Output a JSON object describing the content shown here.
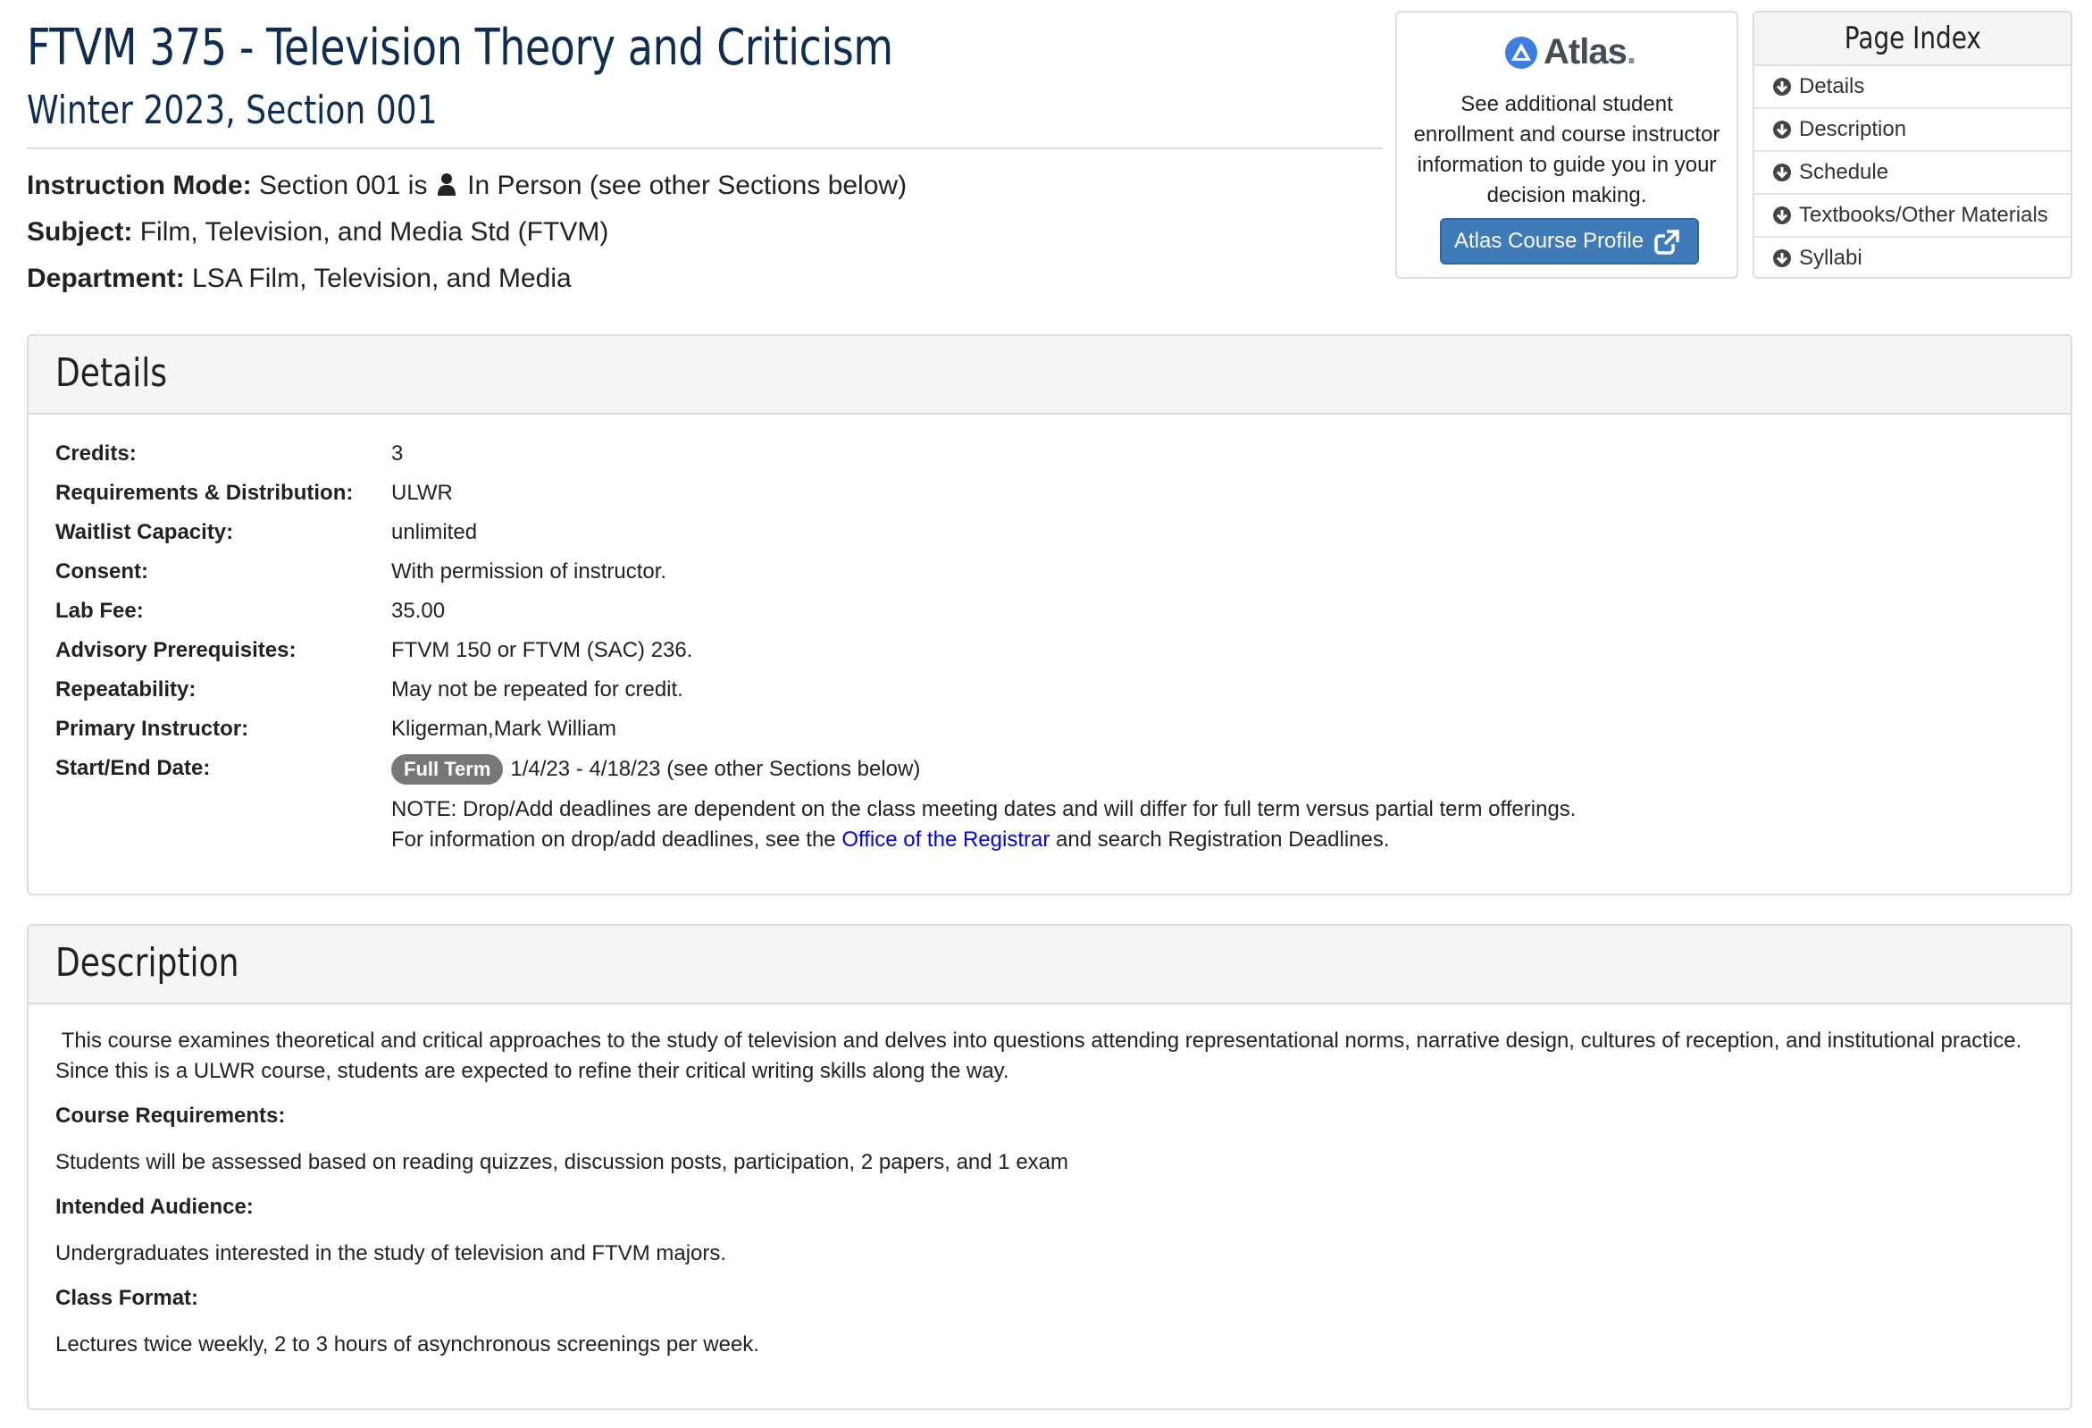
{
  "header": {
    "title": "FTVM 375 - Television Theory and Criticism",
    "subtitle": "Winter 2023, Section 001",
    "instruction_mode_label": "Instruction Mode:",
    "instruction_mode_prefix": "Section 001 is",
    "instruction_mode_value": "In Person (see other Sections below)",
    "subject_label": "Subject:",
    "subject_value": "Film, Television, and Media Std (FTVM)",
    "department_label": "Department:",
    "department_value": "LSA Film, Television, and Media"
  },
  "atlas": {
    "logo_text": "Atlas",
    "logo_dot": ".",
    "text": "See additional student enrollment and course instructor information to guide you in your decision making.",
    "button_label": "Atlas Course Profile",
    "brand_color": "#3f7ab9"
  },
  "page_index": {
    "title": "Page Index",
    "items": [
      "Details",
      "Description",
      "Schedule",
      "Textbooks/Other Materials",
      "Syllabi"
    ]
  },
  "details": {
    "heading": "Details",
    "rows": [
      {
        "label": "Credits:",
        "value": "3"
      },
      {
        "label": "Requirements & Distribution:",
        "value": "ULWR"
      },
      {
        "label": "Waitlist Capacity:",
        "value": "unlimited"
      },
      {
        "label": "Consent:",
        "value": "With permission of instructor."
      },
      {
        "label": "Lab Fee:",
        "value": "35.00"
      },
      {
        "label": "Advisory Prerequisites:",
        "value": "FTVM 150 or FTVM (SAC) 236."
      },
      {
        "label": "Repeatability:",
        "value": "May not be repeated for credit."
      },
      {
        "label": "Primary Instructor:",
        "value": "Kligerman,Mark William"
      },
      {
        "label": "Start/End Date:",
        "value": "1/4/23 - 4/18/23 (see other Sections below)"
      }
    ],
    "term_badge": "Full Term",
    "note_line1": "NOTE: Drop/Add deadlines are dependent on the class meeting dates and will differ for full term versus partial term offerings.",
    "note_line2_prefix": "For information on drop/add deadlines, see the",
    "note_link": "Office of the Registrar",
    "note_line2_suffix": "and search Registration Deadlines."
  },
  "description": {
    "heading": "Description",
    "intro": " This course examines theoretical and critical approaches to the study of television and delves into questions attending representational norms, narrative design, cultures of reception, and institutional practice. Since this is a ULWR course, students are expected to refine their critical writing skills along the way.",
    "course_requirements_label": "Course Requirements:",
    "course_requirements": "Students will be assessed based on reading quizzes, discussion posts, participation, 2 papers, and 1 exam",
    "intended_audience_label": "Intended Audience:",
    "intended_audience": "Undergraduates interested in the study of television and FTVM majors.",
    "class_format_label": "Class Format:",
    "class_format": "Lectures twice weekly, 2 to 3 hours of asynchronous screenings per week."
  },
  "colors": {
    "title": "#0f2d52",
    "link": "#0000ee",
    "badge": "#777777"
  }
}
